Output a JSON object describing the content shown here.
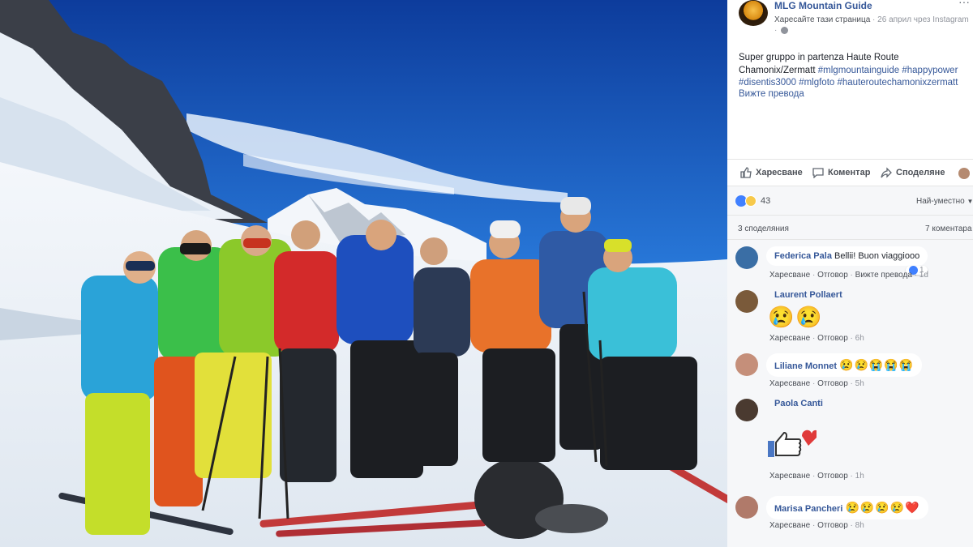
{
  "post": {
    "page_name": "MLG Mountain Guide",
    "like_page_link": "Харесайте тази страница",
    "meta_rest": " · 26 април чрез Instagram",
    "meta_dot": "·",
    "more_icon": "···",
    "text_plain_1": "Super gruppo in partenza Haute Route Chamonix/Zermatt ",
    "hashtags": [
      "#mlgmountainguide",
      "#happypower",
      "#disentis3000",
      "#mlgfoto",
      "#hauteroutechamonixzermatt"
    ],
    "see_translation": "Вижте превода"
  },
  "actions": {
    "like": "Харесване",
    "comment": "Коментар",
    "share": "Споделяне"
  },
  "reactions": {
    "count": "43",
    "sort_label": "Най-уместно",
    "sort_chevron": "▼",
    "shares": "3 споделяния",
    "comments_count": "7 коментара"
  },
  "comments": [
    {
      "name": "Federica Pala",
      "text": "Bellii! Buon viaggiooo",
      "like_label": "Харесване",
      "reply_label": "Отговор",
      "extra": "Вижте превода",
      "time": "1d",
      "likes": "1",
      "avatar_color": "#3a6ea5"
    },
    {
      "name": "Laurent Pollaert",
      "text": "",
      "emoji": "😢😢",
      "like_label": "Харесване",
      "reply_label": "Отговор",
      "time": "6h",
      "avatar_color": "#7a5a3a"
    },
    {
      "name": "Liliane Monnet",
      "text": "",
      "emoji": "😢😢😭😭😭",
      "like_label": "Харесване",
      "reply_label": "Отговор",
      "time": "5h",
      "avatar_color": "#c58f7a"
    },
    {
      "name": "Paola Canti",
      "text": "",
      "sticker": "like-heart-sticker",
      "like_label": "Харесване",
      "reply_label": "Отговор",
      "time": "1h",
      "avatar_color": "#4a3a30"
    },
    {
      "name": "Marisa Pancheri",
      "text": "",
      "emoji": "😢😢😢😢❤️",
      "like_label": "Харесване",
      "reply_label": "Отговор",
      "time": "8h",
      "avatar_color": "#b07a6a"
    }
  ],
  "colors": {
    "link_blue": "#365899",
    "meta_gray": "#90949c",
    "panel_gray": "#f6f7f9",
    "sky": "#1f5fc0"
  }
}
